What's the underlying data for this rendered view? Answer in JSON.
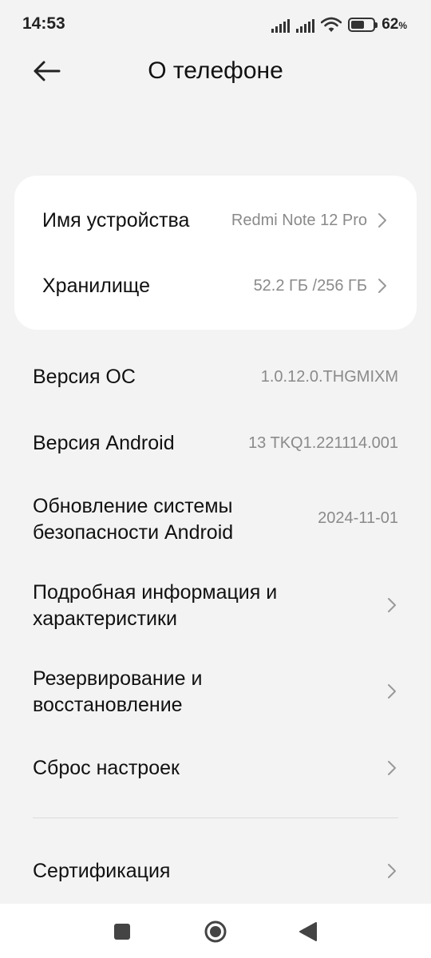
{
  "status": {
    "time": "14:53",
    "battery_percent": "62",
    "battery_unit": "%",
    "battery_level": 0.62
  },
  "header": {
    "title": "О телефоне"
  },
  "card": {
    "device_name": {
      "label": "Имя устройства",
      "value": "Redmi Note 12 Pro"
    },
    "storage": {
      "label": "Хранилище",
      "value": "52.2 ГБ /256 ГБ"
    }
  },
  "items": {
    "os_version": {
      "label": "Версия ОС",
      "value": "1.0.12.0.THGMIXM"
    },
    "android_version": {
      "label": "Версия Android",
      "value": "13 TKQ1.221114.001"
    },
    "security_update": {
      "label_line1": "Обновление системы",
      "label_line2": "безопасности Android",
      "value": "2024-11-01"
    },
    "details": {
      "label_line1": "Подробная информация и",
      "label_line2": "характеристики"
    },
    "backup": {
      "label_line1": "Резервирование и",
      "label_line2": "восстановление"
    },
    "reset": {
      "label": "Сброс настроек"
    },
    "certification": {
      "label": "Сертификация"
    }
  },
  "icons": {
    "back": "arrow-left-icon",
    "chevron": "chevron-right-icon",
    "recents": "square-icon",
    "home": "circle-icon",
    "nav_back": "triangle-back-icon",
    "wifi": "wifi-icon",
    "signal": "signal-icon",
    "battery": "battery-icon"
  },
  "colors": {
    "background": "#f3f3f3",
    "card": "#ffffff",
    "secondary_text": "#8a8a8a"
  }
}
